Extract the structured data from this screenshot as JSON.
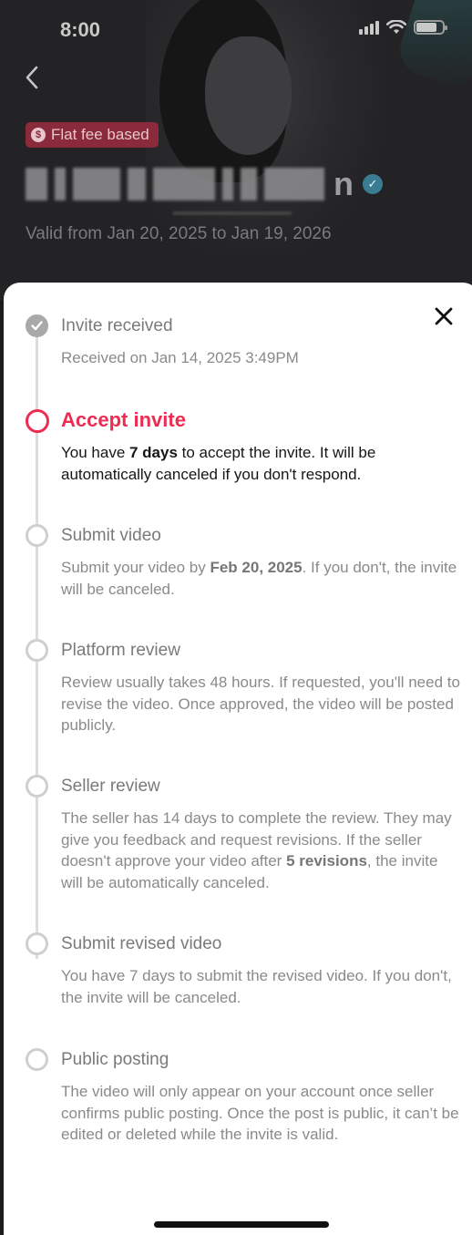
{
  "status_bar": {
    "time": "8:00"
  },
  "header": {
    "badge_label": "Flat fee based",
    "badge_icon": "$",
    "title_visible_suffix": "n",
    "valid_text": "Valid from Jan 20, 2025 to Jan 19, 2026"
  },
  "sheet": {
    "steps": [
      {
        "title": "Invite received",
        "state": "done",
        "body_plain": "Received on Jan 14, 2025 3:49PM"
      },
      {
        "title": "Accept invite",
        "state": "active",
        "body_pre": "You have ",
        "body_bold": "7 days",
        "body_post": " to accept the invite. It will be automatically canceled if you don't respond."
      },
      {
        "title": "Submit video",
        "state": "pending",
        "body_pre": "Submit your video by ",
        "body_bold": "Feb 20, 2025",
        "body_post": ". If you don't, the invite will be canceled."
      },
      {
        "title": "Platform review",
        "state": "pending",
        "body_plain": "Review usually takes 48 hours. If requested, you'll need to revise the video. Once approved, the video will be posted publicly."
      },
      {
        "title": "Seller review",
        "state": "pending",
        "body_pre": "The seller has 14 days to complete the review. They may give you feedback and request revisions. If the seller doesn't approve your video after ",
        "body_bold": "5 revisions",
        "body_post": ", the invite will be automatically canceled."
      },
      {
        "title": "Submit revised video",
        "state": "pending",
        "body_plain": "You have 7 days to submit the revised video. If you don't, the invite will be canceled."
      },
      {
        "title": "Public posting",
        "state": "pending",
        "body_plain": "The video will only appear on your account once seller confirms public posting. Once the post is public, it can’t be edited or deleted while the invite is valid."
      }
    ]
  },
  "colors": {
    "accent": "#ee2c52",
    "badge_bg": "#8a2a3a",
    "verified": "#3a7d93"
  }
}
